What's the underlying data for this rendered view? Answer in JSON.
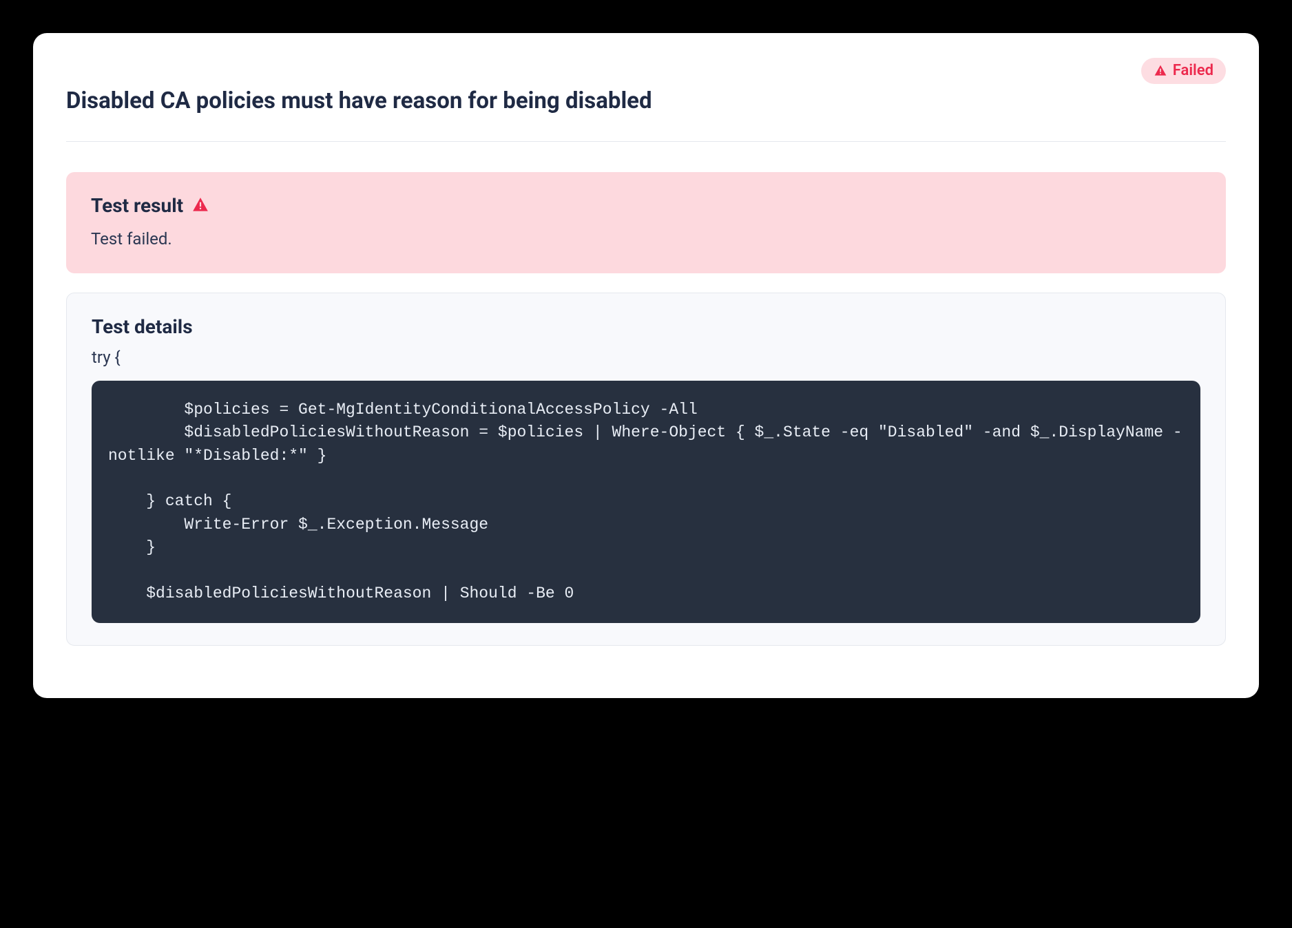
{
  "status": {
    "label": "Failed"
  },
  "title": "Disabled CA policies must have reason for being disabled",
  "result": {
    "heading": "Test result",
    "message": "Test failed."
  },
  "details": {
    "heading": "Test details",
    "try_line": "try {",
    "code": "        $policies = Get-MgIdentityConditionalAccessPolicy -All\n        $disabledPoliciesWithoutReason = $policies | Where-Object { $_.State -eq \"Disabled\" -and $_.DisplayName -notlike \"*Disabled:*\" }\n\n    } catch {\n        Write-Error $_.Exception.Message\n    }\n\n    $disabledPoliciesWithoutReason | Should -Be 0"
  },
  "colors": {
    "danger": "#ec294d",
    "danger_bg": "#fdd9de",
    "code_bg": "#27303f",
    "text_primary": "#1f2a44"
  }
}
